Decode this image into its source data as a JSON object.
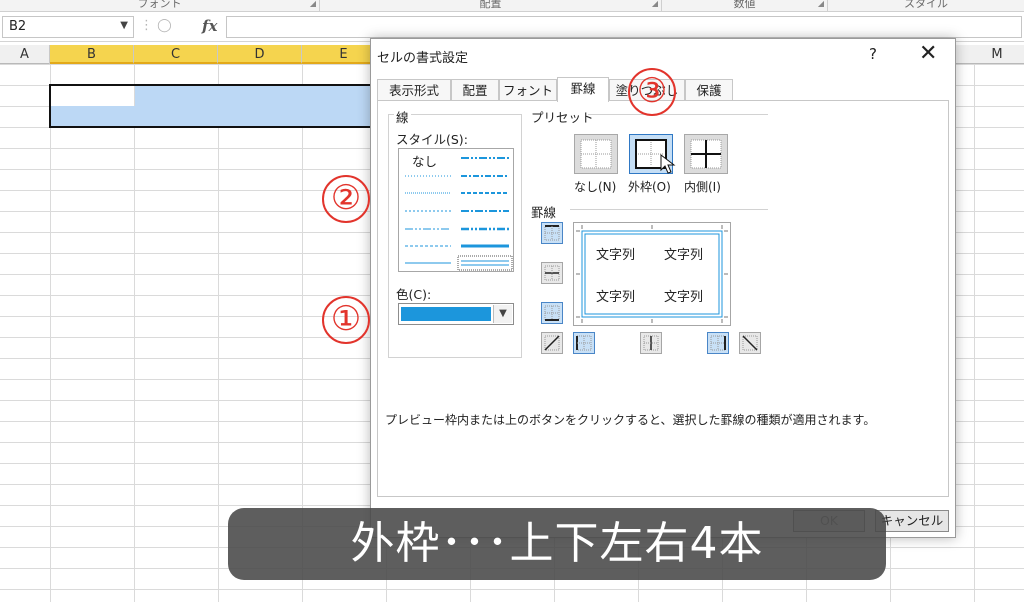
{
  "ribbon": {
    "groups": [
      "フォント",
      "配置",
      "数値",
      "スタイル"
    ]
  },
  "formula_bar": {
    "name_box": "B2",
    "fx_label": "fx"
  },
  "sheet": {
    "columns": [
      "A",
      "B",
      "C",
      "D",
      "E",
      "M"
    ]
  },
  "dialog": {
    "title": "セルの書式設定",
    "help": "?",
    "close": "✕",
    "tabs": [
      "表示形式",
      "配置",
      "フォント",
      "罫線",
      "塗りつぶし",
      "保護"
    ],
    "active_tab": "罫線",
    "line_group": {
      "title": "線",
      "style_label": "スタイル(S):",
      "none_label": "なし",
      "color_label": "色(C):",
      "color": "#1c96dc"
    },
    "preset_group": {
      "title": "プリセット",
      "buttons": [
        "なし(N)",
        "外枠(O)",
        "内側(I)"
      ]
    },
    "border_group": {
      "title": "罫線",
      "preview_texts": [
        "文字列",
        "文字列",
        "文字列",
        "文字列"
      ]
    },
    "hint": "プレビュー枠内または上のボタンをクリックすると、選択した罫線の種類が適用されます。",
    "ok_label": "OK",
    "cancel_label": "キャンセル"
  },
  "annotations": {
    "marker_1": "①",
    "marker_2": "②",
    "marker_3": "③",
    "color": "#e2342c"
  },
  "subtitle": "外枠･･･上下左右4本"
}
